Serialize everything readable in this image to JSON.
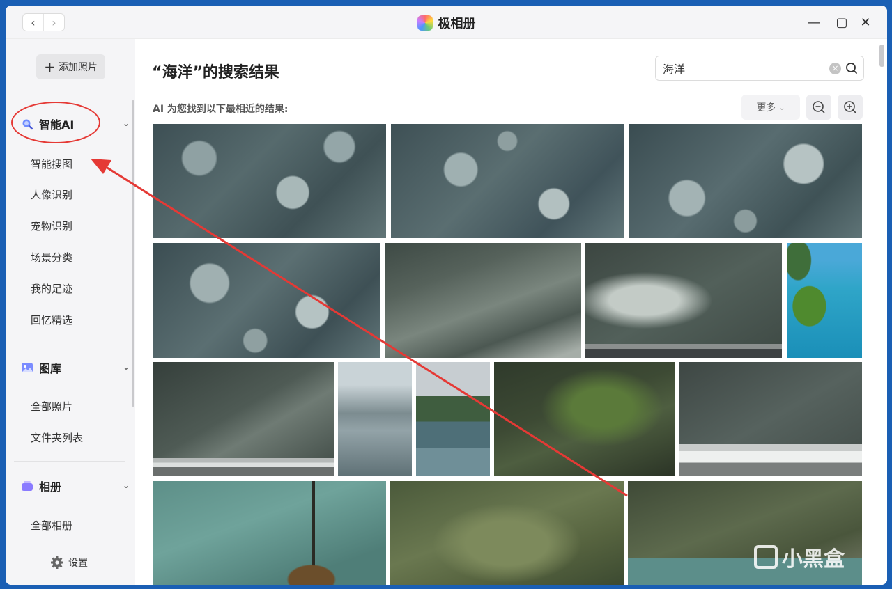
{
  "window": {
    "title": "极相册",
    "back_icon": "chevron-left-icon",
    "forward_icon": "chevron-right-icon",
    "back_glyph": "‹",
    "forward_glyph": "›",
    "minimize_glyph": "—",
    "maximize_glyph": "▢",
    "close_glyph": "✕"
  },
  "sidebar": {
    "add_photo_label": "添加照片",
    "add_photo_glyph": "+",
    "sections": [
      {
        "label": "智能AI",
        "icon": "search-icon",
        "items": [
          "智能搜图",
          "人像识别",
          "宠物识别",
          "场景分类",
          "我的足迹",
          "回忆精选"
        ]
      },
      {
        "label": "图库",
        "icon": "image-icon",
        "items": [
          "全部照片",
          "文件夹列表"
        ]
      },
      {
        "label": "相册",
        "icon": "album-icon",
        "items": [
          "全部相册"
        ]
      }
    ],
    "chevron_glyph": "⌄",
    "settings_label": "设置"
  },
  "main": {
    "page_title": "“海洋”的搜索结果",
    "search_value": "海洋",
    "clear_glyph": "×",
    "subtitle": "AI 为您找到以下最相近的结果:",
    "more_label": "更多",
    "more_chevron": "⌄"
  },
  "watermark": {
    "text": "小黑盒"
  },
  "colors": {
    "accent": "#1a5fb4",
    "annotation": "#e53935"
  }
}
